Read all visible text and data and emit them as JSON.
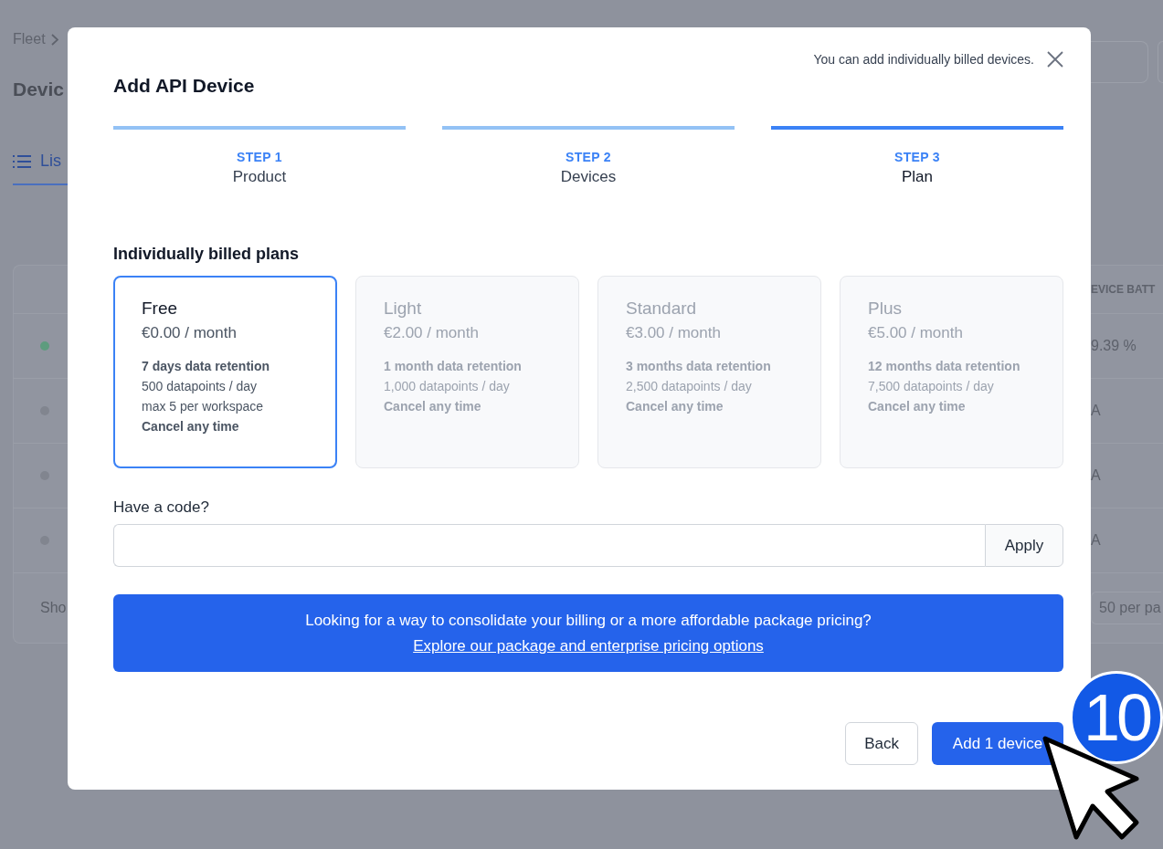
{
  "background_page": {
    "breadcrumb": "Fleet",
    "title": "Devic",
    "tab": {
      "label": "Lis",
      "selected": true
    },
    "table": {
      "column_header": "EVICE BATT",
      "rows": [
        {
          "color": "#5e9c7e",
          "value": "9.39 %"
        },
        {
          "color": "#81858f",
          "value": "A"
        },
        {
          "color": "#81858f",
          "value": "A"
        },
        {
          "color": "#81858f",
          "value": "A"
        }
      ],
      "footer_left": "Sho",
      "footer_right": "50 per pa"
    }
  },
  "dialog": {
    "title": "Add API Device",
    "note": "You can add individually billed devices.",
    "steps": [
      {
        "step": "STEP 1",
        "name": "Product",
        "selected": false
      },
      {
        "step": "STEP 2",
        "name": "Devices",
        "selected": false
      },
      {
        "step": "STEP 3",
        "name": "Plan",
        "selected": true
      }
    ],
    "plans_heading": "Individually billed plans",
    "plans": [
      {
        "name": "Free",
        "price": "€0.00 / month",
        "selected": true,
        "features": [
          {
            "text": "7 days data retention",
            "bold": true
          },
          {
            "text": "500 datapoints / day",
            "bold": false
          },
          {
            "text": "max 5 per workspace",
            "bold": false
          },
          {
            "text": "Cancel any time",
            "bold": true
          }
        ]
      },
      {
        "name": "Light",
        "price": "€2.00 / month",
        "selected": false,
        "features": [
          {
            "text": "1 month data retention",
            "bold": true
          },
          {
            "text": "1,000 datapoints / day",
            "bold": false
          },
          {
            "text": "Cancel any time",
            "bold": true
          }
        ]
      },
      {
        "name": "Standard",
        "price": "€3.00 / month",
        "selected": false,
        "features": [
          {
            "text": "3 months data retention",
            "bold": true
          },
          {
            "text": "2,500 datapoints / day",
            "bold": false
          },
          {
            "text": "Cancel any time",
            "bold": true
          }
        ]
      },
      {
        "name": "Plus",
        "price": "€5.00 / month",
        "selected": false,
        "features": [
          {
            "text": "12 months data retention",
            "bold": true
          },
          {
            "text": "7,500 datapoints / day",
            "bold": false
          },
          {
            "text": "Cancel any time",
            "bold": true
          }
        ]
      }
    ],
    "code_label": "Have a code?",
    "apply_button": "Apply",
    "banner": {
      "text": "Looking for a way to consolidate your billing or a more affordable package pricing?",
      "link": "Explore our package and enterprise pricing options"
    },
    "buttons": [
      "Back",
      "Add 1 device"
    ]
  },
  "step_badge": "10"
}
